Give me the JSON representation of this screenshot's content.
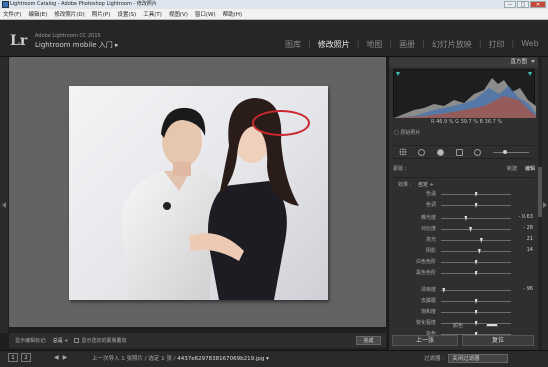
{
  "window": {
    "title": "Lightroom Catalog - Adobe Photoshop Lightroom - 修改照片",
    "controls": [
      "—",
      "□",
      "✕"
    ]
  },
  "menu": [
    "文件(F)",
    "编辑(E)",
    "修改照片(D)",
    "照片(P)",
    "设置(S)",
    "工具(T)",
    "视图(V)",
    "窗口(W)",
    "帮助(H)"
  ],
  "identity": {
    "logo": "Lr",
    "product": "Adobe Lightroom CC 2015",
    "mobile": "Lightroom mobile 入门 ▸"
  },
  "modules": [
    "图库",
    "修改照片",
    "地图",
    "画册",
    "幻灯片放映",
    "打印",
    "Web"
  ],
  "active_module": "修改照片",
  "toolbar": {
    "mode_label": "显示编辑标记:",
    "mode_value": "总是 ÷",
    "checkbox_label": "显示选定的蒙版叠加",
    "done": "完成"
  },
  "right_panel": {
    "histogram_title": "直方图",
    "readout": "R  46.9  %   G  39.7  %   B  36.7  %",
    "original_photo": "原始照片",
    "tab_left": "蒙版 :",
    "tab_new": "新建",
    "tab_edit": "编辑",
    "treatment_label": "效果 :",
    "treatment_value": "自定 ÷",
    "sliders": [
      {
        "label": "色温",
        "value": "",
        "pos": 0.5
      },
      {
        "label": "色调",
        "value": "",
        "pos": 0.5
      },
      {
        "label": "曝光度",
        "value": "- 0.63",
        "pos": 0.35
      },
      {
        "label": "对比度",
        "value": "- 28",
        "pos": 0.42
      },
      {
        "label": "高光",
        "value": "21",
        "pos": 0.58
      },
      {
        "label": "阴影",
        "value": "14",
        "pos": 0.55
      },
      {
        "label": "白色色阶",
        "value": "",
        "pos": 0.5
      },
      {
        "label": "黑色色阶",
        "value": "",
        "pos": 0.5
      },
      {
        "label": "清晰度",
        "value": "- 96",
        "pos": 0.02
      },
      {
        "label": "去朦胧",
        "value": "",
        "pos": 0.5
      },
      {
        "label": "饱和度",
        "value": "",
        "pos": 0.5
      },
      {
        "label": "锐化程度",
        "value": "",
        "pos": 0.5
      },
      {
        "label": "杂色",
        "value": "",
        "pos": 0.5
      }
    ],
    "color_label": "颜色",
    "prev_button": "上一张",
    "reset_button": "复位"
  },
  "bottom": {
    "icons": [
      "1",
      "2"
    ],
    "nav": [
      "◀",
      "▶"
    ],
    "text_prefix": "上一次导入",
    "text_count": "1 张照片 / 选定 1 张 /",
    "filename": "4437e6297838167069b219.jpg ▾",
    "filter_label": "过滤器 :",
    "filter_value": "关闭过滤器"
  },
  "colors": {
    "annotation": "#c8282e",
    "active_module": "#eeeeee"
  }
}
